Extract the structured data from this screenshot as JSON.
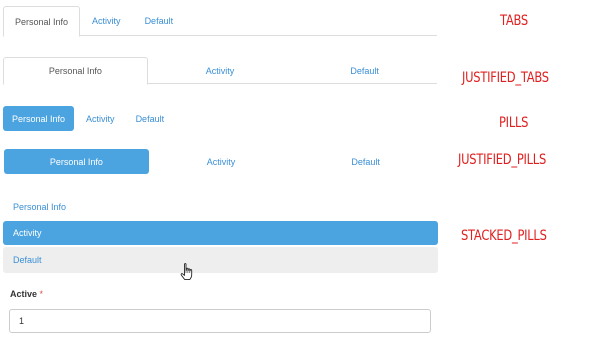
{
  "tabs": {
    "items": [
      {
        "label": "Personal Info",
        "active": true
      },
      {
        "label": "Activity",
        "active": false
      },
      {
        "label": "Default",
        "active": false
      }
    ]
  },
  "justified_tabs": {
    "items": [
      {
        "label": "Personal Info",
        "active": true
      },
      {
        "label": "Activity",
        "active": false
      },
      {
        "label": "Default",
        "active": false
      }
    ]
  },
  "pills": {
    "items": [
      {
        "label": "Personal Info",
        "active": true
      },
      {
        "label": "Activity",
        "active": false
      },
      {
        "label": "Default",
        "active": false
      }
    ]
  },
  "justified_pills": {
    "items": [
      {
        "label": "Personal Info",
        "active": true
      },
      {
        "label": "Activity",
        "active": false
      },
      {
        "label": "Default",
        "active": false
      }
    ]
  },
  "stacked_pills": {
    "items": [
      {
        "label": "Personal Info",
        "active": false
      },
      {
        "label": "Activity",
        "active": true
      },
      {
        "label": "Default",
        "active": false,
        "hovered": true
      }
    ]
  },
  "form": {
    "label": "Active",
    "required_mark": "*",
    "value": "1"
  },
  "annotations": {
    "tabs": "TABS",
    "justified_tabs": "JUSTIFIED_TABS",
    "pills": "PILLS",
    "justified_pills": "JUSTIFIED_PILLS",
    "stacked_pills": "STACKED_PILLS"
  },
  "cursor": {
    "icon": "pointer-hand-icon"
  },
  "colors": {
    "accent": "#4ba3e0",
    "link": "#3a8fd6",
    "annotation": "#e02020",
    "hover_bg": "#eeeeee",
    "required": "#d9534f"
  }
}
